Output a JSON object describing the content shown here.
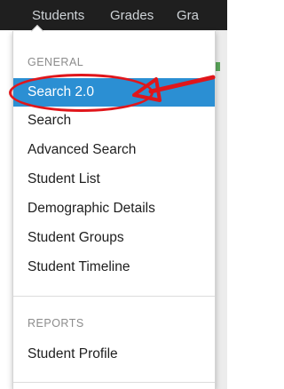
{
  "navbar": {
    "items": [
      {
        "label": "Students"
      },
      {
        "label": "Grades"
      },
      {
        "label": "Gra"
      }
    ]
  },
  "menu": {
    "sections": [
      {
        "header": "GENERAL",
        "items": [
          {
            "label": "Search 2.0",
            "active": true
          },
          {
            "label": "Search"
          },
          {
            "label": "Advanced Search"
          },
          {
            "label": "Student List"
          },
          {
            "label": "Demographic Details"
          },
          {
            "label": "Student Groups"
          },
          {
            "label": "Student Timeline"
          }
        ]
      },
      {
        "header": "REPORTS",
        "items": [
          {
            "label": "Student Profile"
          }
        ]
      }
    ]
  },
  "annotation": {
    "color": "#e0161b",
    "shapes": [
      "ellipse",
      "arrow"
    ]
  },
  "colors": {
    "navbar_bg": "#1f1f1f",
    "active_bg": "#2b8fd3"
  }
}
